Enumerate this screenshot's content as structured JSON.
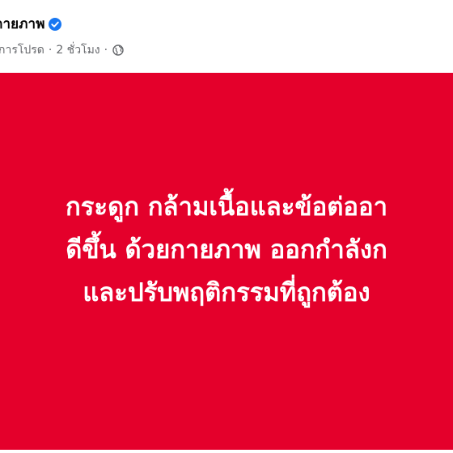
{
  "post": {
    "page_name": "ตกายภาพ",
    "meta": {
      "audience_label": "การโปรด",
      "separator": "·",
      "time_ago": "2 ชั่วโมง",
      "privacy_icon": "globe-icon"
    },
    "verified_icon": "verified-badge-icon",
    "image": {
      "background_color": "#e4002b",
      "text_color": "#ffffff",
      "lines": [
        "กระดูก กล้ามเนื้อและข้อต่ออา",
        "ดีขึ้น ด้วยกายภาพ ออกกำลังก",
        "และปรับพฤติกรรมที่ถูกต้อง"
      ]
    }
  },
  "colors": {
    "accent_verified": "#1877f2",
    "meta_text": "#65676b",
    "name_text": "#050505"
  }
}
